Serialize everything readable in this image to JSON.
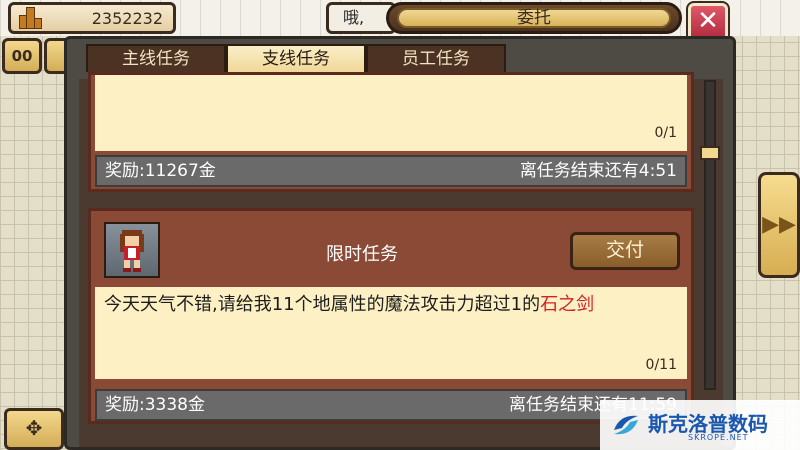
{
  "hud": {
    "money": "2352232",
    "dialog_snippet": "哦,",
    "window_title": "委托",
    "close_glyph": "✕",
    "pause_label": "00",
    "next_glyph": "▶▶",
    "move_glyph": "✥"
  },
  "tabs": [
    {
      "label": "主线任务",
      "active": false
    },
    {
      "label": "支线任务",
      "active": true
    },
    {
      "label": "员工任务",
      "active": false
    }
  ],
  "quests": [
    {
      "progress": "0/1",
      "reward": "奖励:11267金",
      "time_left": "离任务结束还有4:51"
    },
    {
      "title": "限时任务",
      "submit_label": "交付",
      "desc_prefix": "今天天气不错,请给我11个地属性的魔法攻击力超过1的",
      "desc_item": "石之剑",
      "progress": "0/11",
      "reward": "奖励:3338金",
      "time_left": "离任务结束还有11:59"
    }
  ],
  "watermark": {
    "name": "斯克洛普数码",
    "site": "SKROPE.NET"
  },
  "colors": {
    "item_highlight": "#d0202a",
    "tab_active": "#efd898",
    "reward_bar": "#696a69"
  }
}
